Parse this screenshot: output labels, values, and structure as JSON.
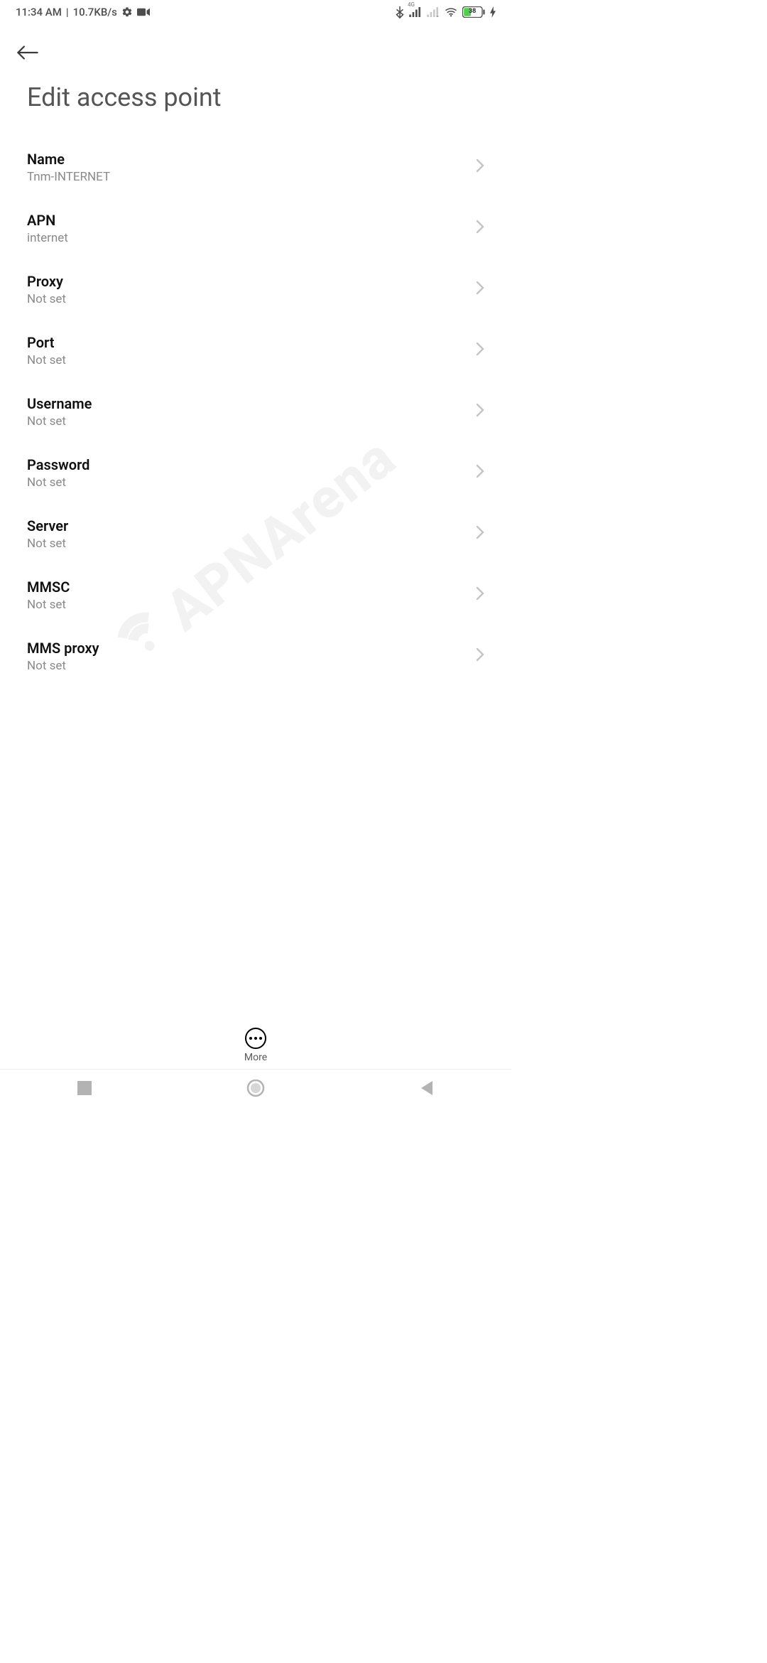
{
  "status_bar": {
    "time": "11:34 AM",
    "separator": "|",
    "speed": "10.7KB/s",
    "fourg_label": "4G",
    "battery_percent": "38"
  },
  "header": {
    "title": "Edit access point"
  },
  "settings": [
    {
      "title": "Name",
      "value": "Tnm-INTERNET"
    },
    {
      "title": "APN",
      "value": "internet"
    },
    {
      "title": "Proxy",
      "value": "Not set"
    },
    {
      "title": "Port",
      "value": "Not set"
    },
    {
      "title": "Username",
      "value": "Not set"
    },
    {
      "title": "Password",
      "value": "Not set"
    },
    {
      "title": "Server",
      "value": "Not set"
    },
    {
      "title": "MMSC",
      "value": "Not set"
    },
    {
      "title": "MMS proxy",
      "value": "Not set"
    }
  ],
  "more_button": {
    "label": "More"
  },
  "watermark": {
    "text": "APNArena"
  }
}
